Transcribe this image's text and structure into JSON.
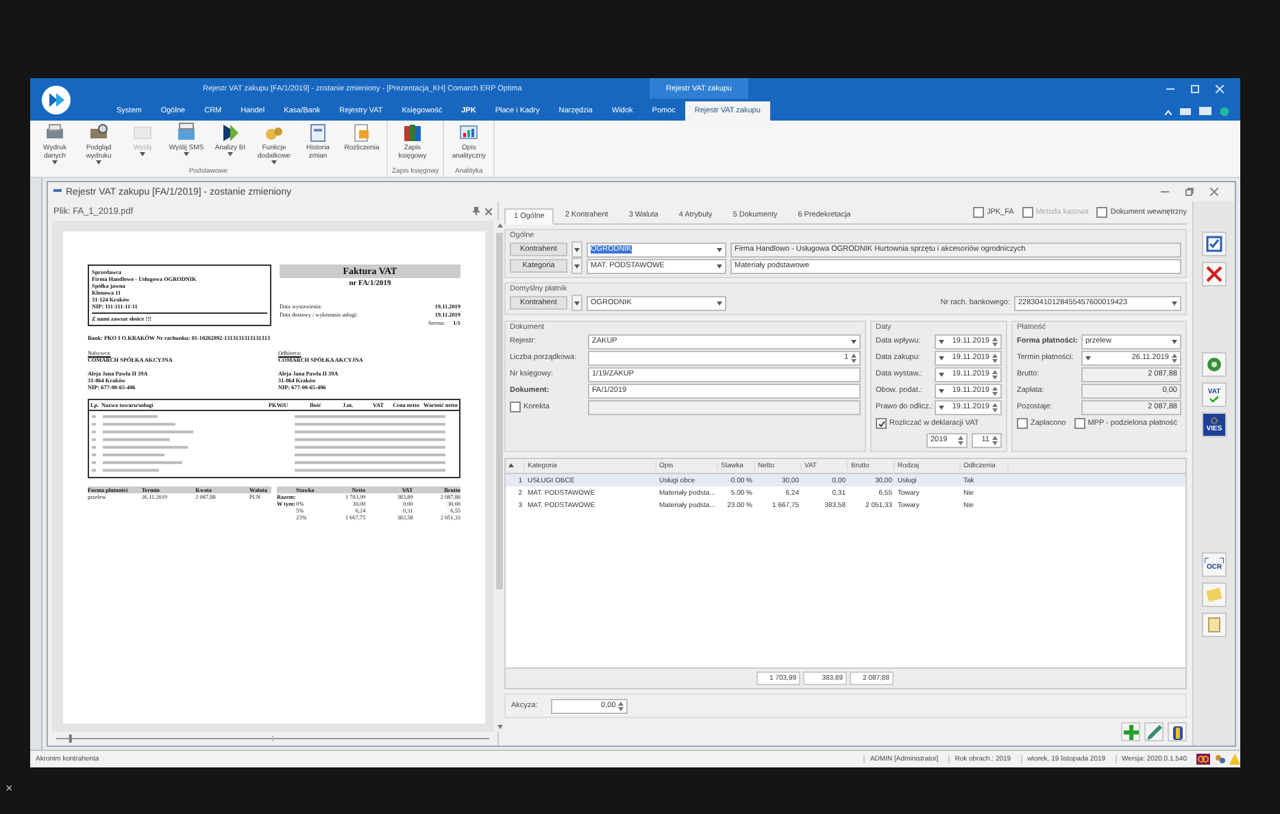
{
  "window": {
    "title": "Rejestr VAT zakupu [FA/1/2019] - zostanie zmieniony - [Prezentacja_KH] Comarch ERP Optima",
    "context_group": "Rejestr VAT zakupu"
  },
  "menu_tabs": [
    {
      "label": "System",
      "selected": false
    },
    {
      "label": "Ogólne",
      "selected": false
    },
    {
      "label": "CRM",
      "selected": false
    },
    {
      "label": "Handel",
      "selected": false
    },
    {
      "label": "Kasa/Bank",
      "selected": false
    },
    {
      "label": "Rejestry VAT",
      "selected": false
    },
    {
      "label": "Księgowość",
      "selected": false
    },
    {
      "label": "JPK",
      "selected": false,
      "bold": true
    },
    {
      "label": "Płace i Kadry",
      "selected": false
    },
    {
      "label": "Narzędzia",
      "selected": false
    },
    {
      "label": "Widok",
      "selected": false
    },
    {
      "label": "Pomoc",
      "selected": false
    },
    {
      "label": "Rejestr VAT zakupu",
      "selected": true
    }
  ],
  "ribbon": [
    {
      "label": "Podstawowe",
      "buttons": [
        {
          "kind": "printer",
          "label": "Wydruk danych",
          "dropdown": true
        },
        {
          "kind": "preview",
          "label": "Podgląd wydruku",
          "dropdown": true
        },
        {
          "kind": "send",
          "label": "Wyślij",
          "dropdown": true,
          "disabled": true
        },
        {
          "kind": "sms",
          "label": "Wyślij SMS",
          "dropdown": true
        },
        {
          "kind": "bi",
          "label": "Analizy BI",
          "dropdown": true
        },
        {
          "kind": "functions",
          "label": "Funkcje dodatkowe",
          "dropdown": true
        },
        {
          "kind": "history",
          "label": "Historia zmian",
          "dropdown": false
        },
        {
          "kind": "settle",
          "label": "Rozliczenia",
          "dropdown": false
        }
      ]
    },
    {
      "label": "Zapis księgowy",
      "buttons": [
        {
          "kind": "books",
          "label": "Zapis księgowy",
          "dropdown": false
        }
      ]
    },
    {
      "label": "Analityka",
      "buttons": [
        {
          "kind": "analytics",
          "label": "Opis analityczny",
          "dropdown": false
        }
      ]
    }
  ],
  "document_window": {
    "title": "Rejestr VAT zakupu [FA/1/2019] - zostanie zmieniony"
  },
  "preview": {
    "file": "Plik: FA_1_2019.pdf",
    "zoom": {
      "level": 0.03
    },
    "invoice": {
      "seller_heading": "Sprzedawca",
      "seller_lines": [
        "Firma Handlowo - Usługowa OGRODNIK",
        "Spółka jawna",
        "Klonowa 11",
        "31-124 Kraków",
        "NIP: 111-111-11-11"
      ],
      "slogan": "Z nami zawsze słońce !!!",
      "title": "Faktura VAT",
      "number": "nr FA/1/2019",
      "dates": [
        {
          "label": "Data wystawienia:",
          "value": "19.11.2019"
        },
        {
          "label": "Data dostawy / wykonania usługi:",
          "value": "19.11.2019"
        }
      ],
      "page_label": "Strona:",
      "page": "1/1",
      "bank": "Bank: PKO I O.KRAKÓW   Nr rachunku: 81-10202892-1313131313131313",
      "parties": [
        {
          "heading": "Nabywca:",
          "name": "COMARCH SPÓŁKA AKCYJNA",
          "lines": [
            "Aleja Jana Pawła II 39A",
            "31-864 Kraków",
            "NIP: 677-00-65-406"
          ]
        },
        {
          "heading": "Odbiorca:",
          "name": "COMARCH SPÓŁKA AKCYJNA",
          "lines": [
            "Aleja Jana Pawła II 39A",
            "31-864 Kraków",
            "NIP: 677-00-65-406"
          ]
        }
      ],
      "item_columns": [
        "Lp.",
        "Nazwa towaru/usługi",
        "PKWiU",
        "Ilość",
        "J.m.",
        "VAT",
        "Cena netto",
        "Wartość netto"
      ],
      "payment_columns": [
        "Forma płatności",
        "Termin",
        "Kwota",
        "Waluta"
      ],
      "payment": [
        "przelew",
        "26.11.2019",
        "2 087,88",
        "PLN"
      ],
      "summary_columns": [
        "Stawka",
        "Netto",
        "VAT",
        "Brutto"
      ],
      "summary_rows": [
        [
          "Razem:",
          "",
          "1 703,99",
          "383,89",
          "2 087,88"
        ],
        [
          "W tym:",
          "0%",
          "30,00",
          "0,00",
          "30,00"
        ],
        [
          "",
          "5%",
          "6,24",
          "0,31",
          "6,55"
        ],
        [
          "",
          "23%",
          "1 667,75",
          "383,58",
          "2 051,33"
        ]
      ]
    }
  },
  "form_tabs": [
    {
      "label": "1 Ogólne",
      "selected": true
    },
    {
      "label": "2 Kontrahent",
      "selected": false
    },
    {
      "label": "3 Waluta",
      "selected": false
    },
    {
      "label": "4 Atrybuty",
      "selected": false
    },
    {
      "label": "5 Dokumenty",
      "selected": false
    },
    {
      "label": "6 Predekretacja",
      "selected": false
    }
  ],
  "header_checks": [
    {
      "label": "JPK_FA",
      "checked": false,
      "disabled": false
    },
    {
      "label": "Metoda kasowa",
      "checked": false,
      "disabled": true
    },
    {
      "label": "Dokument wewnętrzny",
      "checked": false,
      "disabled": false
    }
  ],
  "general": {
    "title": "Ogólne",
    "rows": [
      {
        "button": "Kontrahent",
        "code": "OGRODNIK",
        "code_selected": true,
        "description": "Firma Handlowo - Usługowa OGRODNIK Hurtownia sprzętu i akcesoriów ogrodniczych"
      },
      {
        "button": "Kategoria",
        "code": "MAT. PODSTAWOWE",
        "code_selected": false,
        "description": "Materiały podstawowe"
      }
    ]
  },
  "payer": {
    "title": "Domyślny płatnik",
    "button": "Kontrahent",
    "code": "OGRODNIK",
    "account_label": "Nr rach. bankowego:",
    "account": "22830410128455457600019423"
  },
  "document": {
    "title": "Dokument",
    "register_label": "Rejestr:",
    "register": "ZAKUP",
    "number_label": "Liczba porządkowa:",
    "number": "1",
    "book_label": "Nr księgowy:",
    "book": "1/19/ZAKUP",
    "doc_label": "Dokument:",
    "doc": "FA/1/2019",
    "correction": {
      "label": "Korekta",
      "checked": false
    }
  },
  "dates": {
    "title": "Daty",
    "rows": [
      {
        "label": "Data wpływu:",
        "value": "19.11.2019"
      },
      {
        "label": "Data zakupu:",
        "value": "19.11.2019"
      },
      {
        "label": "Data wystaw.:",
        "value": "19.11.2019"
      },
      {
        "label": "Obow. podat.:",
        "value": "19.11.2019"
      },
      {
        "label": "Prawo do odlicz.:",
        "value": "19.11.2019"
      }
    ],
    "declaration": {
      "label": "Rozliczać w deklaracji VAT",
      "checked": true
    },
    "year": "2019",
    "month": "11"
  },
  "payment": {
    "title": "Płatność",
    "method_label": "Forma płatności:",
    "method": "przelew",
    "due_label": "Termin płatności:",
    "due": "26.11.2019",
    "rows": [
      {
        "label": "Brutto:",
        "value": "2 087,88"
      },
      {
        "label": "Zapłata:",
        "value": "0,00"
      },
      {
        "label": "Pozostaje:",
        "value": "2 087,88"
      }
    ],
    "checks": [
      {
        "label": "Zapłacono",
        "checked": false
      },
      {
        "label": "MPP - podzielona płatność",
        "checked": false
      }
    ]
  },
  "table": {
    "columns": [
      "",
      "Kategoria",
      "Opis",
      "Stawka",
      "Netto",
      "VAT",
      "Brutto",
      "Rodzaj",
      "Odliczenia"
    ],
    "rows": [
      {
        "selected": true,
        "cells": [
          "1",
          "USŁUGI OBCE",
          "Usługi obce",
          "0.00 %",
          "30,00",
          "0,00",
          "30,00",
          "Usługi",
          "Tak"
        ]
      },
      {
        "selected": false,
        "cells": [
          "2",
          "MAT. PODSTAWOWE",
          "Materiały podsta...",
          "5.00 %",
          "6,24",
          "0,31",
          "6,55",
          "Towary",
          "Nie"
        ]
      },
      {
        "selected": false,
        "cells": [
          "3",
          "MAT. PODSTAWOWE",
          "Materiały podsta...",
          "23.00 %",
          "1 667,75",
          "383,58",
          "2 051,33",
          "Towary",
          "Nie"
        ]
      }
    ],
    "totals": [
      "1 703,99",
      "383,89",
      "2 087,88"
    ]
  },
  "excise": {
    "label": "Akcyza:",
    "value": "0,00"
  },
  "side_tools": [
    {
      "kind": "save"
    },
    {
      "kind": "cancel"
    },
    {
      "kind": "money"
    },
    {
      "kind": "vat",
      "label": "VAT"
    },
    {
      "kind": "vies",
      "label": "VIES"
    },
    {
      "kind": "ocr",
      "label": "OCR"
    },
    {
      "kind": "note"
    },
    {
      "kind": "clip"
    }
  ],
  "row_tools": [
    {
      "kind": "add"
    },
    {
      "kind": "edit"
    },
    {
      "kind": "delete"
    }
  ],
  "status_bar": {
    "hint": "Akronim kontrahenta",
    "items": [
      "ADMIN [Administrator]",
      "Rok obrach.: 2019",
      "wtorek, 19 listopada 2019",
      "Wersja: 2020.0.1.540"
    ]
  },
  "bezel_close": "×"
}
